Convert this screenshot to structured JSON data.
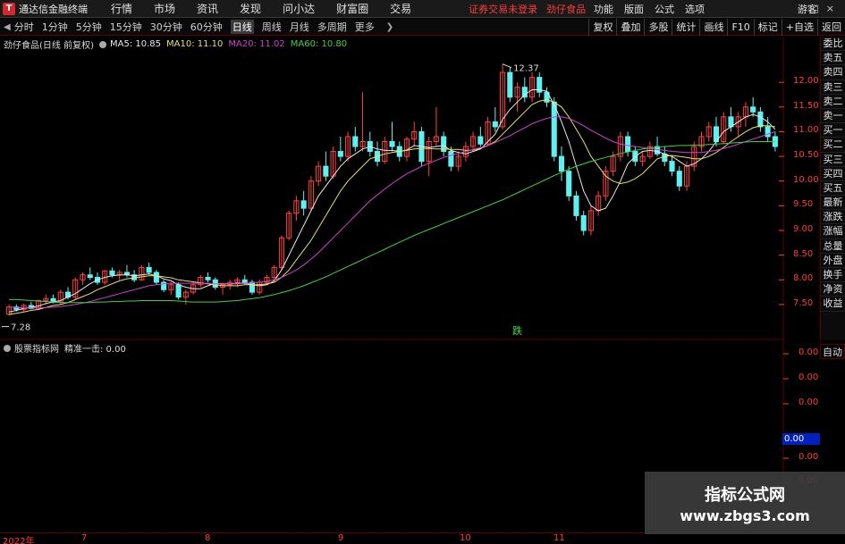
{
  "menubar": {
    "app_title": "通达信金融终端",
    "items": [
      "行情",
      "市场",
      "资讯",
      "发现",
      "问小达",
      "财富圈",
      "交易"
    ],
    "status_text": "证券交易未登录",
    "stock_name": "劲仔食品",
    "right_items": [
      "功能",
      "版面",
      "公式",
      "选项"
    ],
    "right_label": "游客"
  },
  "periodbar": {
    "periods": [
      "分时",
      "1分钟",
      "5分钟",
      "15分钟",
      "30分钟",
      "60分钟",
      "日线",
      "周线",
      "月线",
      "多周期",
      "更多"
    ],
    "active_period": "日线",
    "tools": [
      "复权",
      "叠加",
      "多股",
      "统计",
      "画线",
      "F10",
      "标记",
      "+自选",
      "返回"
    ]
  },
  "header": {
    "stock_title": "劲仔食品(日线 前复权)",
    "ma5": "MA5: 10.85",
    "ma10": "MA10: 11.10",
    "ma20": "MA20: 11.02",
    "ma60": "MA60: 10.80"
  },
  "colors": {
    "up": "#ff4040",
    "down": "#5ff0f0",
    "ma5": "#e8e8e8",
    "ma10": "#e8e060",
    "ma20": "#d040d0",
    "ma60": "#40d040",
    "axis": "#ff3a3a",
    "border": "#5a0000"
  },
  "price_axis": [
    "12.00",
    "11.50",
    "11.00",
    "10.50",
    "10.00",
    "9.50",
    "9.00",
    "8.50",
    "8.00",
    "7.50"
  ],
  "annotations": {
    "high_label": "12.37",
    "low_label": "7.28",
    "signal": "跌"
  },
  "sidetabs": [
    "委比",
    "卖五",
    "卖四",
    "卖三",
    "卖二",
    "卖一",
    "买一",
    "买二",
    "买三",
    "买四",
    "买五",
    "最新",
    "涨跌",
    "涨幅",
    "总量",
    "外盘",
    "换手",
    "净资",
    "收益"
  ],
  "sub": {
    "title": "股票指标网",
    "indicator": "精准一击: 0.00",
    "auto_label": "自动",
    "axis": [
      "0.00",
      "0.00",
      "0.00",
      "0.00",
      "0.00"
    ],
    "current": "0.00"
  },
  "timeaxis": [
    "2022年",
    "7",
    "8",
    "9",
    "10",
    "11"
  ],
  "watermark": {
    "title": "指标公式网",
    "url": "www.zbgs3.com"
  },
  "chart_data": {
    "type": "candlestick",
    "ylim": [
      7.1,
      12.6
    ],
    "ohlc": [
      [
        7.3,
        7.5,
        7.27,
        7.45
      ],
      [
        7.45,
        7.5,
        7.36,
        7.4
      ],
      [
        7.4,
        7.52,
        7.35,
        7.48
      ],
      [
        7.48,
        7.55,
        7.4,
        7.42
      ],
      [
        7.42,
        7.6,
        7.4,
        7.58
      ],
      [
        7.58,
        7.7,
        7.5,
        7.62
      ],
      [
        7.62,
        7.7,
        7.52,
        7.55
      ],
      [
        7.55,
        7.8,
        7.5,
        7.75
      ],
      [
        7.75,
        7.85,
        7.6,
        7.65
      ],
      [
        7.65,
        8.05,
        7.6,
        8.0
      ],
      [
        8.0,
        8.15,
        7.9,
        8.1
      ],
      [
        8.1,
        8.25,
        8.0,
        8.05
      ],
      [
        8.05,
        8.15,
        7.9,
        7.95
      ],
      [
        7.95,
        8.2,
        7.9,
        8.18
      ],
      [
        8.18,
        8.25,
        8.05,
        8.1
      ],
      [
        8.1,
        8.2,
        8.0,
        8.15
      ],
      [
        8.15,
        8.3,
        8.05,
        8.1
      ],
      [
        8.1,
        8.2,
        7.95,
        8.0
      ],
      [
        8.0,
        8.3,
        7.98,
        8.25
      ],
      [
        8.25,
        8.35,
        8.1,
        8.15
      ],
      [
        8.15,
        8.2,
        7.9,
        7.95
      ],
      [
        7.95,
        8.0,
        7.75,
        7.8
      ],
      [
        7.8,
        7.95,
        7.7,
        7.9
      ],
      [
        7.9,
        7.95,
        7.6,
        7.65
      ],
      [
        7.65,
        7.8,
        7.5,
        7.75
      ],
      [
        7.75,
        7.95,
        7.7,
        7.9
      ],
      [
        7.9,
        8.1,
        7.85,
        8.05
      ],
      [
        8.05,
        8.15,
        7.95,
        8.0
      ],
      [
        8.0,
        8.05,
        7.8,
        7.85
      ],
      [
        7.85,
        7.95,
        7.7,
        7.9
      ],
      [
        7.9,
        8.0,
        7.8,
        7.95
      ],
      [
        7.95,
        8.05,
        7.85,
        8.0
      ],
      [
        8.0,
        8.1,
        7.9,
        7.95
      ],
      [
        7.95,
        8.0,
        7.7,
        7.75
      ],
      [
        7.75,
        8.0,
        7.7,
        7.95
      ],
      [
        7.95,
        8.1,
        7.9,
        8.05
      ],
      [
        8.05,
        8.3,
        8.0,
        8.25
      ],
      [
        8.25,
        8.9,
        8.2,
        8.85
      ],
      [
        8.85,
        9.4,
        8.8,
        9.35
      ],
      [
        9.35,
        9.7,
        9.2,
        9.6
      ],
      [
        9.6,
        9.8,
        9.3,
        9.45
      ],
      [
        9.45,
        10.1,
        9.4,
        10.0
      ],
      [
        10.0,
        10.4,
        9.9,
        10.3
      ],
      [
        10.3,
        10.6,
        10.0,
        10.1
      ],
      [
        10.1,
        10.7,
        10.05,
        10.6
      ],
      [
        10.6,
        10.9,
        10.4,
        10.5
      ],
      [
        10.5,
        11.0,
        10.4,
        10.9
      ],
      [
        10.9,
        11.1,
        10.6,
        10.7
      ],
      [
        10.7,
        11.8,
        10.6,
        10.8
      ],
      [
        10.8,
        11.0,
        10.5,
        10.6
      ],
      [
        10.6,
        10.8,
        10.3,
        10.4
      ],
      [
        10.4,
        10.9,
        10.35,
        10.8
      ],
      [
        10.8,
        11.2,
        10.6,
        10.7
      ],
      [
        10.7,
        10.8,
        10.4,
        10.5
      ],
      [
        10.5,
        10.9,
        10.4,
        10.85
      ],
      [
        10.85,
        11.2,
        10.7,
        11.0
      ],
      [
        11.0,
        11.1,
        10.3,
        10.4
      ],
      [
        10.4,
        10.9,
        10.1,
        10.8
      ],
      [
        10.8,
        11.5,
        10.7,
        10.9
      ],
      [
        10.9,
        11.0,
        10.5,
        10.6
      ],
      [
        10.6,
        10.7,
        10.2,
        10.3
      ],
      [
        10.3,
        10.6,
        10.2,
        10.5
      ],
      [
        10.5,
        10.8,
        10.4,
        10.7
      ],
      [
        10.7,
        11.0,
        10.6,
        10.9
      ],
      [
        10.9,
        11.1,
        10.7,
        10.75
      ],
      [
        10.75,
        11.3,
        10.7,
        11.2
      ],
      [
        11.2,
        11.5,
        11.0,
        11.1
      ],
      [
        11.1,
        12.37,
        11.05,
        12.2
      ],
      [
        12.2,
        12.3,
        11.6,
        11.7
      ],
      [
        11.7,
        12.0,
        11.4,
        11.9
      ],
      [
        11.9,
        12.1,
        11.6,
        11.7
      ],
      [
        11.7,
        12.2,
        11.6,
        12.1
      ],
      [
        12.1,
        12.2,
        11.7,
        11.8
      ],
      [
        11.8,
        11.9,
        11.5,
        11.6
      ],
      [
        11.6,
        11.7,
        10.4,
        10.5
      ],
      [
        10.5,
        10.7,
        10.0,
        10.2
      ],
      [
        10.2,
        10.3,
        9.6,
        9.7
      ],
      [
        9.7,
        9.8,
        9.2,
        9.3
      ],
      [
        9.3,
        9.4,
        8.9,
        9.0
      ],
      [
        9.0,
        9.5,
        8.9,
        9.4
      ],
      [
        9.4,
        9.8,
        9.3,
        9.7
      ],
      [
        9.7,
        10.3,
        9.6,
        10.2
      ],
      [
        10.2,
        10.6,
        10.1,
        10.5
      ],
      [
        10.5,
        11.0,
        10.4,
        10.9
      ],
      [
        10.9,
        11.0,
        10.5,
        10.6
      ],
      [
        10.6,
        10.7,
        10.3,
        10.4
      ],
      [
        10.4,
        10.6,
        10.3,
        10.5
      ],
      [
        10.5,
        10.8,
        10.45,
        10.7
      ],
      [
        10.7,
        10.9,
        10.5,
        10.55
      ],
      [
        10.55,
        10.7,
        10.3,
        10.4
      ],
      [
        10.4,
        10.5,
        10.1,
        10.2
      ],
      [
        10.2,
        10.3,
        9.8,
        9.9
      ],
      [
        9.9,
        10.4,
        9.8,
        10.3
      ],
      [
        10.3,
        10.8,
        10.2,
        10.7
      ],
      [
        10.7,
        11.0,
        10.6,
        10.9
      ],
      [
        10.9,
        11.2,
        10.8,
        11.1
      ],
      [
        11.1,
        11.3,
        10.7,
        10.8
      ],
      [
        10.8,
        11.4,
        10.75,
        11.3
      ],
      [
        11.3,
        11.5,
        11.0,
        11.1
      ],
      [
        11.1,
        11.4,
        10.9,
        11.3
      ],
      [
        11.3,
        11.6,
        11.1,
        11.5
      ],
      [
        11.5,
        11.7,
        11.3,
        11.4
      ],
      [
        11.4,
        11.5,
        11.0,
        11.1
      ],
      [
        11.1,
        11.3,
        10.8,
        10.9
      ],
      [
        10.9,
        11.0,
        10.6,
        10.7
      ]
    ],
    "ma_lines": [
      {
        "name": "MA5",
        "values": [
          7.35,
          7.38,
          7.42,
          7.44,
          7.47,
          7.52,
          7.55,
          7.58,
          7.65,
          7.72,
          7.82,
          7.92,
          8.0,
          8.05,
          8.08,
          8.1,
          8.1,
          8.08,
          8.1,
          8.12,
          8.08,
          8.02,
          7.98,
          7.9,
          7.85,
          7.82,
          7.82,
          7.88,
          7.93,
          7.92,
          7.92,
          7.93,
          7.93,
          7.9,
          7.88,
          7.9,
          7.98,
          8.2,
          8.5,
          8.8,
          9.1,
          9.4,
          9.7,
          9.9,
          10.1,
          10.3,
          10.45,
          10.55,
          10.65,
          10.7,
          10.65,
          10.62,
          10.62,
          10.6,
          10.63,
          10.72,
          10.7,
          10.68,
          10.7,
          10.72,
          10.62,
          10.58,
          10.55,
          10.6,
          10.65,
          10.8,
          10.95,
          11.25,
          11.45,
          11.6,
          11.75,
          11.85,
          11.85,
          11.82,
          11.55,
          11.2,
          10.8,
          10.3,
          9.8,
          9.5,
          9.4,
          9.45,
          9.7,
          10.0,
          10.35,
          10.5,
          10.6,
          10.62,
          10.6,
          10.55,
          10.5,
          10.4,
          10.3,
          10.35,
          10.45,
          10.6,
          10.8,
          11.0,
          11.1,
          11.2,
          11.3,
          11.35,
          11.3,
          11.2,
          11.05
        ]
      },
      {
        "name": "MA10",
        "values": [
          7.3,
          7.32,
          7.35,
          7.38,
          7.4,
          7.44,
          7.48,
          7.5,
          7.54,
          7.6,
          7.66,
          7.72,
          7.8,
          7.86,
          7.92,
          7.98,
          8.02,
          8.04,
          8.06,
          8.08,
          8.08,
          8.06,
          8.04,
          8.0,
          7.98,
          7.96,
          7.94,
          7.92,
          7.9,
          7.88,
          7.88,
          7.88,
          7.9,
          7.9,
          7.9,
          7.92,
          7.95,
          8.05,
          8.2,
          8.4,
          8.6,
          8.8,
          9.05,
          9.3,
          9.55,
          9.8,
          10.0,
          10.15,
          10.3,
          10.45,
          10.5,
          10.55,
          10.58,
          10.6,
          10.62,
          10.65,
          10.66,
          10.66,
          10.65,
          10.65,
          10.64,
          10.64,
          10.62,
          10.63,
          10.66,
          10.72,
          10.8,
          10.95,
          11.1,
          11.25,
          11.4,
          11.55,
          11.62,
          11.65,
          11.6,
          11.5,
          11.3,
          11.05,
          10.8,
          10.5,
          10.3,
          10.1,
          10.0,
          9.95,
          9.98,
          10.05,
          10.15,
          10.3,
          10.45,
          10.5,
          10.52,
          10.5,
          10.48,
          10.45,
          10.45,
          10.5,
          10.58,
          10.68,
          10.8,
          10.9,
          11.0,
          11.08,
          11.12,
          11.12,
          11.1
        ]
      },
      {
        "name": "MA20",
        "values": [
          7.45,
          7.44,
          7.43,
          7.43,
          7.43,
          7.44,
          7.45,
          7.46,
          7.48,
          7.5,
          7.53,
          7.56,
          7.6,
          7.64,
          7.68,
          7.72,
          7.76,
          7.8,
          7.84,
          7.88,
          7.9,
          7.92,
          7.93,
          7.93,
          7.93,
          7.93,
          7.93,
          7.93,
          7.92,
          7.92,
          7.92,
          7.92,
          7.93,
          7.94,
          7.95,
          7.97,
          8.0,
          8.05,
          8.12,
          8.2,
          8.3,
          8.42,
          8.55,
          8.7,
          8.85,
          9.0,
          9.15,
          9.3,
          9.45,
          9.6,
          9.72,
          9.84,
          9.95,
          10.05,
          10.15,
          10.22,
          10.3,
          10.36,
          10.42,
          10.48,
          10.52,
          10.56,
          10.6,
          10.64,
          10.68,
          10.72,
          10.78,
          10.85,
          10.92,
          11.0,
          11.08,
          11.16,
          11.22,
          11.27,
          11.3,
          11.3,
          11.27,
          11.2,
          11.12,
          11.03,
          10.95,
          10.87,
          10.8,
          10.75,
          10.72,
          10.7,
          10.68,
          10.66,
          10.64,
          10.62,
          10.6,
          10.59,
          10.58,
          10.58,
          10.58,
          10.6,
          10.62,
          10.66,
          10.7,
          10.75,
          10.8,
          10.85,
          10.9,
          10.95,
          11.0
        ]
      },
      {
        "name": "MA60",
        "values": [
          7.6,
          7.6,
          7.59,
          7.58,
          7.57,
          7.56,
          7.55,
          7.54,
          7.54,
          7.54,
          7.54,
          7.54,
          7.55,
          7.55,
          7.56,
          7.56,
          7.57,
          7.57,
          7.58,
          7.58,
          7.58,
          7.58,
          7.58,
          7.57,
          7.56,
          7.55,
          7.55,
          7.55,
          7.55,
          7.56,
          7.57,
          7.58,
          7.6,
          7.62,
          7.64,
          7.67,
          7.7,
          7.74,
          7.78,
          7.83,
          7.88,
          7.94,
          8.0,
          8.06,
          8.13,
          8.2,
          8.27,
          8.34,
          8.41,
          8.48,
          8.55,
          8.62,
          8.69,
          8.76,
          8.83,
          8.9,
          8.96,
          9.02,
          9.08,
          9.14,
          9.2,
          9.26,
          9.32,
          9.38,
          9.44,
          9.5,
          9.56,
          9.62,
          9.69,
          9.76,
          9.83,
          9.9,
          9.97,
          10.04,
          10.11,
          10.18,
          10.24,
          10.3,
          10.35,
          10.4,
          10.44,
          10.48,
          10.52,
          10.56,
          10.59,
          10.62,
          10.65,
          10.67,
          10.69,
          10.7,
          10.71,
          10.72,
          10.72,
          10.73,
          10.73,
          10.74,
          10.75,
          10.76,
          10.77,
          10.78,
          10.79,
          10.8,
          10.8,
          10.8,
          10.8
        ]
      }
    ]
  }
}
